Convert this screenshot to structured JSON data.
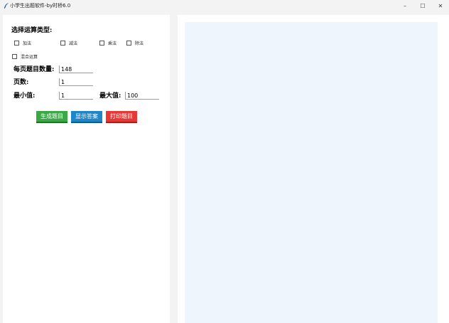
{
  "window": {
    "title": "小学生出题软件-by时桥6.0",
    "minimize_glyph": "–",
    "maximize_glyph": "☐",
    "close_glyph": "✕",
    "app_icon": "feather-icon"
  },
  "form": {
    "operation_title": "选择运算类型:",
    "operations": [
      {
        "label": "加法",
        "checked": false
      },
      {
        "label": "减法",
        "checked": false
      },
      {
        "label": "乘法",
        "checked": false
      },
      {
        "label": "除法",
        "checked": false
      },
      {
        "label": "混合运算",
        "checked": false
      }
    ],
    "per_page_label": "每页题目数量:",
    "per_page_value": "148",
    "pages_label": "页数:",
    "pages_value": "1",
    "min_label": "最小值:",
    "min_value": "1",
    "max_label": "最大值:",
    "max_value": "100"
  },
  "buttons": {
    "generate": "生成题目",
    "show_answers": "显示答案",
    "print": "打印题目"
  },
  "colors": {
    "generate": "#3aa845",
    "show_answers": "#1f86c8",
    "print": "#e53935",
    "output_bg": "#eef5fd"
  }
}
